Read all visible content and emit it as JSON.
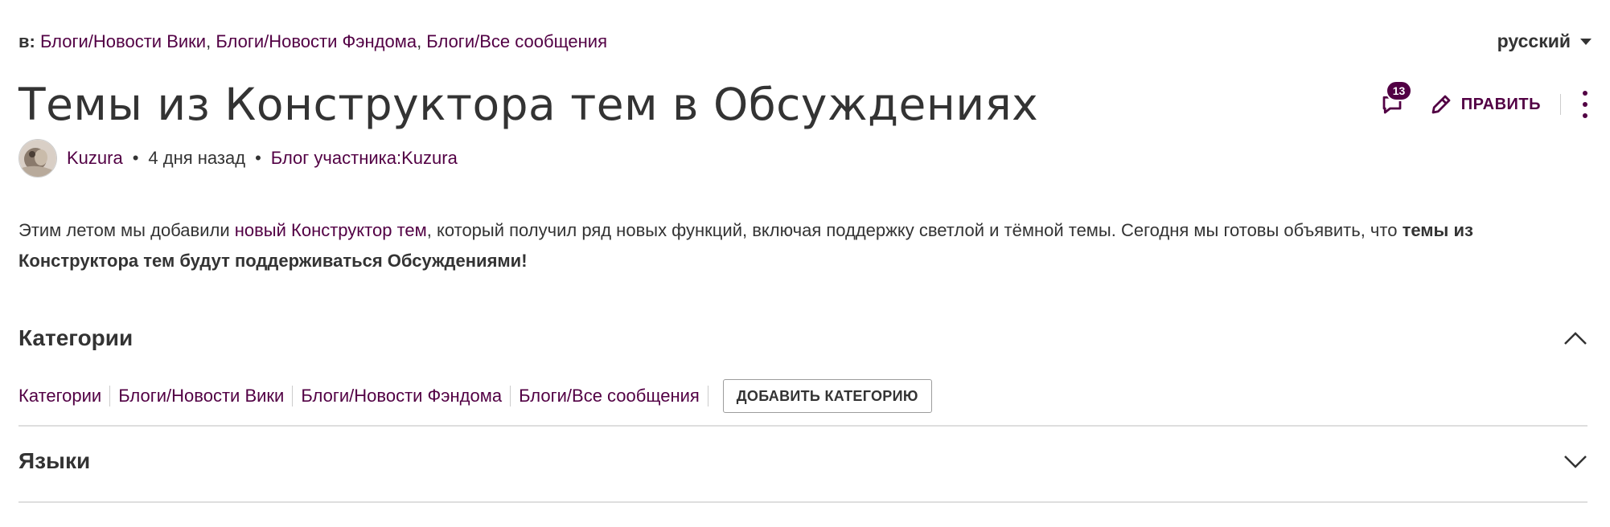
{
  "breadcrumb": {
    "prefix": "в:",
    "links": [
      "Блоги/Новости Вики",
      "Блоги/Новости Фэндома",
      "Блоги/Все сообщения"
    ],
    "separator": ", "
  },
  "language": {
    "selected": "русский",
    "icon": "chevron-down-icon"
  },
  "title": "Темы из Конструктора тем в Обсуждениях",
  "actions": {
    "comments_count": "13",
    "edit_label": "ПРАВИТЬ"
  },
  "meta": {
    "author": "Kuzura",
    "time": "4 дня назад",
    "blog_link": "Блог участника:Kuzura",
    "separator": "•"
  },
  "body": {
    "before_link": "Этим летом мы добавили ",
    "link": "новый Конструктор тем",
    "after_link": ", который получил ряд новых функций, включая поддержку светлой и тёмной темы. Сегодня мы готовы объявить, что ",
    "bold": "темы из Конструктора тем будут поддерживаться Обсуждениями!"
  },
  "categories": {
    "title": "Категории",
    "items": [
      "Категории",
      "Блоги/Новости Вики",
      "Блоги/Новости Фэндома",
      "Блоги/Все сообщения"
    ],
    "add_label": "ДОБАВИТЬ КАТЕГОРИЮ"
  },
  "languages": {
    "title": "Языки"
  },
  "colors": {
    "link": "#520044",
    "text": "#333333",
    "divider": "#dedede"
  }
}
